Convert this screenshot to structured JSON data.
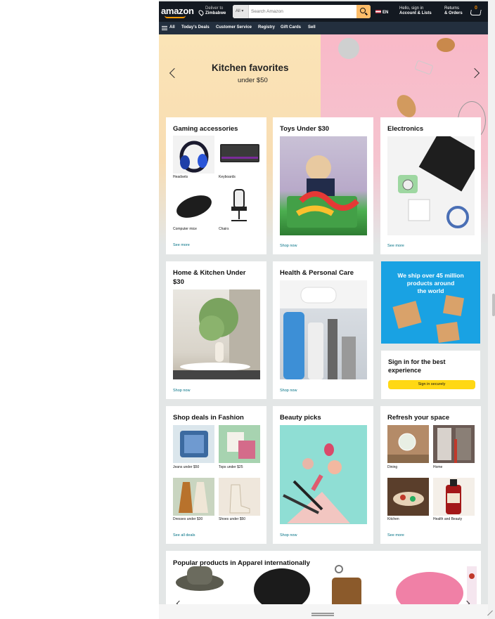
{
  "header": {
    "logo": "amazon",
    "deliver_line1": "Deliver to",
    "deliver_line2": "Zimbabwe",
    "search_category": "All",
    "search_placeholder": "Search Amazon",
    "language": "EN",
    "account_line1": "Hello, sign in",
    "account_line2": "Account & Lists",
    "orders_line1": "Returns",
    "orders_line2": "& Orders",
    "cart_count": "0"
  },
  "nav": {
    "all": "All",
    "items": [
      "Today's Deals",
      "Customer Service",
      "Registry",
      "Gift Cards",
      "Sell"
    ]
  },
  "hero": {
    "title": "Kitchen favorites",
    "subtitle": "under $50"
  },
  "cards": {
    "gaming": {
      "title": "Gaming accessories",
      "items": [
        "Headsets",
        "Keyboards",
        "Computer mice",
        "Chairs"
      ],
      "link": "See more"
    },
    "toys": {
      "title": "Toys Under $30",
      "link": "Shop now"
    },
    "electronics": {
      "title": "Electronics",
      "link": "See more"
    },
    "home_kitchen": {
      "title_line1": "Home & Kitchen Under",
      "title_line2": "$30",
      "link": "Shop now"
    },
    "health": {
      "title": "Health & Personal Care",
      "link": "Shop now"
    },
    "ship_banner": {
      "line1": "We ship over 45 million",
      "line2": "products around",
      "line3": "the world"
    },
    "signin": {
      "title_line1": "Sign in for the best",
      "title_line2": "experience",
      "button": "Sign in securely"
    },
    "fashion": {
      "title": "Shop deals in Fashion",
      "items": [
        "Jeans under $50",
        "Tops under $25",
        "Dresses under $30",
        "Shoes under $50"
      ],
      "link": "See all deals"
    },
    "beauty": {
      "title": "Beauty picks",
      "link": "Shop now"
    },
    "refresh": {
      "title": "Refresh your space",
      "items": [
        "Dining",
        "Home",
        "Kitchen",
        "Health and Beauty"
      ],
      "link": "See more"
    }
  },
  "popular": {
    "title": "Popular products in Apparel internationally"
  }
}
